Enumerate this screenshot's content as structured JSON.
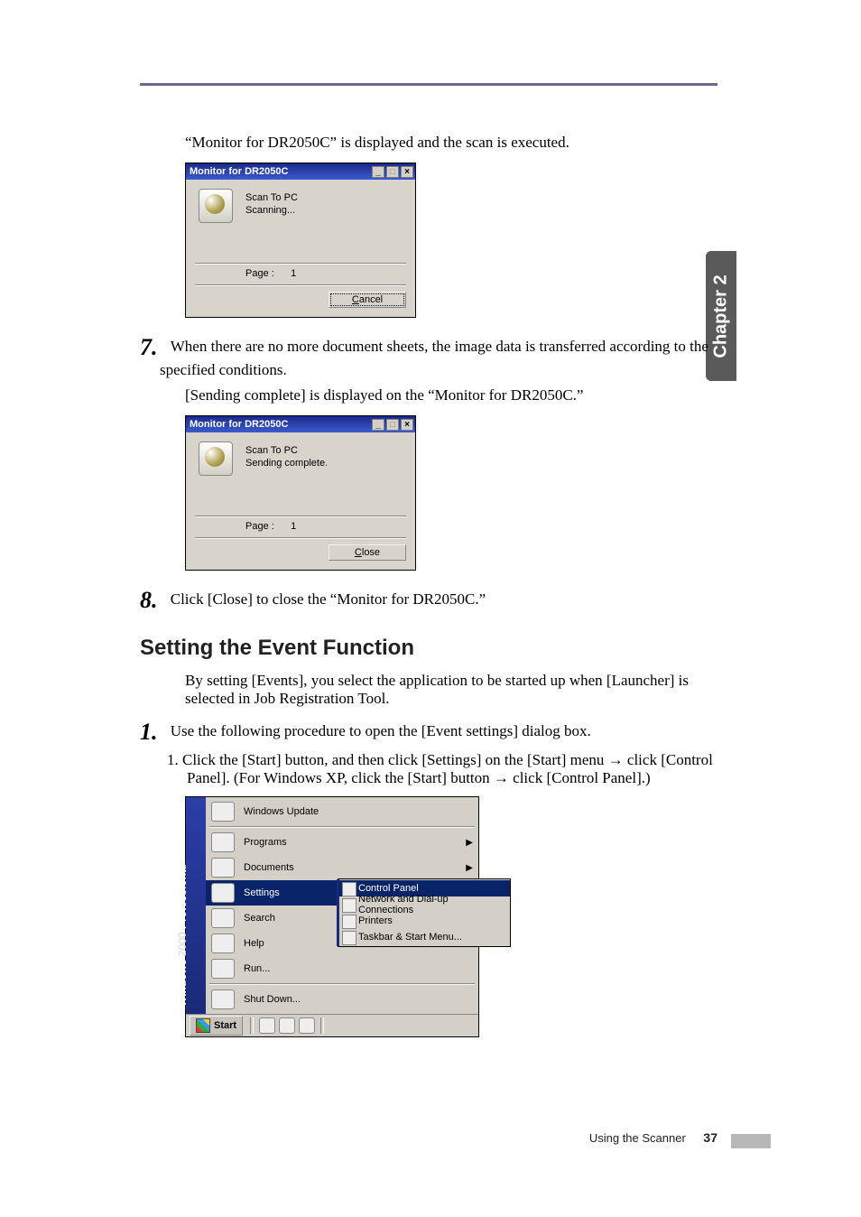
{
  "chapterTab": "Chapter 2",
  "intro": "“Monitor for DR2050C” is displayed and the scan is executed.",
  "dialog1": {
    "title": "Monitor for DR2050C",
    "mode": "Scan To PC",
    "status": "Scanning...",
    "pageLabel": "Page :",
    "pageValue": "1",
    "button": "Cancel"
  },
  "step7": {
    "num": "7.",
    "text": "When there are no more document sheets, the image data is transferred according to the specified conditions.",
    "sub": "[Sending complete] is displayed on the “Monitor for DR2050C.”"
  },
  "dialog2": {
    "title": "Monitor for DR2050C",
    "mode": "Scan To PC",
    "status": "Sending complete.",
    "pageLabel": "Page :",
    "pageValue": "1",
    "button": "Close"
  },
  "step8": {
    "num": "8.",
    "text": "Click [Close] to close the “Monitor for DR2050C.”"
  },
  "sectionHeading": "Setting the Event Function",
  "sectionIntro": "By setting [Events], you select the application to be started up when [Launcher] is selected in Job Registration Tool.",
  "step1": {
    "num": "1.",
    "text": "Use the following procedure to open the [Event settings] dialog box.",
    "sub1": "1. Click the [Start] button, and then click [Settings] on the [Start] menu → click [Control Panel]. (For Windows XP, click the [Start] button → click [Control Panel].)"
  },
  "startMenu": {
    "sideBrand1": "Windows",
    "sideBrand2": " 2000 ",
    "sideBrand3": "Professional",
    "items": {
      "windowsUpdate": "Windows Update",
      "programs": "Programs",
      "documents": "Documents",
      "settings": "Settings",
      "search": "Search",
      "help": "Help",
      "run": "Run...",
      "shutdown": "Shut Down..."
    },
    "flyout": {
      "controlPanel": "Control Panel",
      "network": "Network and Dial-up Connections",
      "printers": "Printers",
      "taskbar": "Taskbar & Start Menu..."
    },
    "taskbar": {
      "startLabel": "Start"
    }
  },
  "footer": {
    "label": "Using the Scanner",
    "page": "37"
  }
}
